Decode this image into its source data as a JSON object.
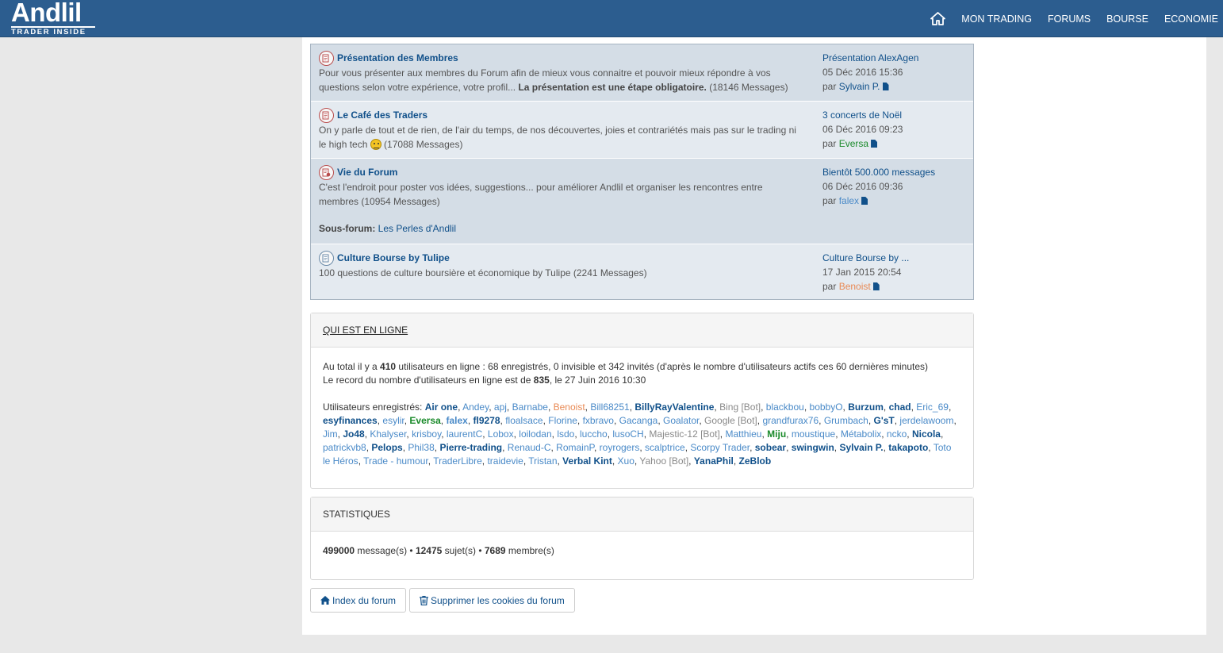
{
  "header": {
    "logo_main": "Andlil",
    "logo_sub": "TRADER INSIDE",
    "nav": [
      "MON TRADING",
      "FORUMS",
      "BOURSE",
      "ECONOMIE"
    ]
  },
  "forums": [
    {
      "title": "Présentation des Membres",
      "desc_start": "Pour vous présenter aux membres du Forum afin de mieux vous connaitre et pouvoir mieux répondre à vos questions selon votre expérience, votre profil... ",
      "desc_bold": "La présentation est une étape obligatoire.",
      "desc_count": " (18146 Messages)",
      "last_title": "Présentation AlexAgen",
      "last_date": "05 Déc 2016 15:36",
      "last_by_prefix": "par ",
      "last_author": "Sylvain P."
    },
    {
      "title": "Le Café des Traders",
      "desc_start": "On y parle de tout et de rien, de l'air du temps, de nos découvertes, joies et contrariétés mais pas sur le trading ni le high tech ",
      "desc_count": " (17088 Messages)",
      "last_title": "3 concerts de Noël",
      "last_date": "06 Déc 2016 09:23",
      "last_by_prefix": "par ",
      "last_author": "Eversa"
    },
    {
      "title": "Vie du Forum",
      "desc_start": "C'est l'endroit pour poster vos idées, suggestions... pour améliorer Andlil et organiser les rencontres entre membres",
      "desc_count": " (10954 Messages)",
      "subforum_label": "Sous-forum:",
      "subforum_link": "Les Perles d'Andlil",
      "last_title": "Bientôt 500.000 messages",
      "last_date": "06 Déc 2016 09:36",
      "last_by_prefix": "par ",
      "last_author": "falex"
    },
    {
      "title": "Culture Bourse by Tulipe",
      "desc_start": "100 questions de culture boursière et économique by Tulipe",
      "desc_count": " (2241 Messages)",
      "last_title": "Culture Bourse by ...",
      "last_date": "17 Jan 2015 20:54",
      "last_by_prefix": "par ",
      "last_author": "Benoist"
    }
  ],
  "online": {
    "title": "QUI EST EN LIGNE",
    "line1_a": "Au total il y a ",
    "line1_total": "410",
    "line1_b": " utilisateurs en ligne : 68 enregistrés, 0 invisible et 342 invités (d'après le nombre d'utilisateurs actifs ces 60 dernières minutes)",
    "line2_a": "Le record du nombre d'utilisateurs en ligne est de ",
    "line2_record": "835",
    "line2_b": ", le 27 Juin 2016 10:30",
    "users_label": "Utilisateurs enregistrés: ",
    "users": [
      {
        "n": "Air one",
        "c": "blue",
        "b": true
      },
      {
        "n": "Andey",
        "c": "light"
      },
      {
        "n": "apj",
        "c": "light"
      },
      {
        "n": "Barnabe",
        "c": "light"
      },
      {
        "n": "Benoist",
        "c": "orange"
      },
      {
        "n": "Bill68251",
        "c": "light"
      },
      {
        "n": "BillyRayValentine",
        "c": "blue",
        "b": true
      },
      {
        "n": "Bing [Bot]",
        "c": "grey"
      },
      {
        "n": "blackbou",
        "c": "light"
      },
      {
        "n": "bobbyO",
        "c": "light"
      },
      {
        "n": "Burzum",
        "c": "blue",
        "b": true
      },
      {
        "n": "chad",
        "c": "blue",
        "b": true
      },
      {
        "n": "Eric_69",
        "c": "light"
      },
      {
        "n": "esyfinances",
        "c": "blue",
        "b": true
      },
      {
        "n": "esylir",
        "c": "light"
      },
      {
        "n": "Eversa",
        "c": "green",
        "b": true
      },
      {
        "n": "falex",
        "c": "light",
        "b": true
      },
      {
        "n": "fl9278",
        "c": "blue",
        "b": true
      },
      {
        "n": "floalsace",
        "c": "light"
      },
      {
        "n": "Florine",
        "c": "light"
      },
      {
        "n": "fxbravo",
        "c": "light"
      },
      {
        "n": "Gacanga",
        "c": "light"
      },
      {
        "n": "Goalator",
        "c": "light"
      },
      {
        "n": "Google [Bot]",
        "c": "grey"
      },
      {
        "n": "grandfurax76",
        "c": "light"
      },
      {
        "n": "Grumbach",
        "c": "light"
      },
      {
        "n": "G'sT",
        "c": "blue",
        "b": true
      },
      {
        "n": "jerdelawoom",
        "c": "light"
      },
      {
        "n": "Jim",
        "c": "light"
      },
      {
        "n": "Jo48",
        "c": "blue",
        "b": true
      },
      {
        "n": "Khalyser",
        "c": "light"
      },
      {
        "n": "krisboy",
        "c": "light"
      },
      {
        "n": "laurentC",
        "c": "light"
      },
      {
        "n": "Lobox",
        "c": "light"
      },
      {
        "n": "loilodan",
        "c": "light"
      },
      {
        "n": "lsdo",
        "c": "light"
      },
      {
        "n": "luccho",
        "c": "light"
      },
      {
        "n": "lusoCH",
        "c": "light"
      },
      {
        "n": "Majestic-12 [Bot]",
        "c": "grey"
      },
      {
        "n": "Matthieu",
        "c": "light"
      },
      {
        "n": "Miju",
        "c": "green",
        "b": true
      },
      {
        "n": "moustique",
        "c": "light"
      },
      {
        "n": "Métabolix",
        "c": "light"
      },
      {
        "n": "ncko",
        "c": "light"
      },
      {
        "n": "Nicola",
        "c": "blue",
        "b": true
      },
      {
        "n": "patrickvb8",
        "c": "light"
      },
      {
        "n": "Pelops",
        "c": "blue",
        "b": true
      },
      {
        "n": "Phil38",
        "c": "light"
      },
      {
        "n": "Pierre-trading",
        "c": "blue",
        "b": true
      },
      {
        "n": "Renaud-C",
        "c": "light"
      },
      {
        "n": "RomainP",
        "c": "light"
      },
      {
        "n": "royrogers",
        "c": "light"
      },
      {
        "n": "scalptrice",
        "c": "light"
      },
      {
        "n": "Scorpy Trader",
        "c": "light"
      },
      {
        "n": "sobear",
        "c": "blue",
        "b": true
      },
      {
        "n": "swingwin",
        "c": "blue",
        "b": true
      },
      {
        "n": "Sylvain P.",
        "c": "blue",
        "b": true
      },
      {
        "n": "takapoto",
        "c": "blue",
        "b": true
      },
      {
        "n": "Toto le Héros",
        "c": "light"
      },
      {
        "n": "Trade - humour",
        "c": "light"
      },
      {
        "n": "TraderLibre",
        "c": "light"
      },
      {
        "n": "traidevie",
        "c": "light"
      },
      {
        "n": "Tristan",
        "c": "light"
      },
      {
        "n": "Verbal Kint",
        "c": "blue",
        "b": true
      },
      {
        "n": "Xuo",
        "c": "light"
      },
      {
        "n": "Yahoo [Bot]",
        "c": "grey"
      },
      {
        "n": "YanaPhil",
        "c": "blue",
        "b": true
      },
      {
        "n": "ZeBlob",
        "c": "blue",
        "b": true
      }
    ]
  },
  "stats": {
    "title": "STATISTIQUES",
    "messages": "499000",
    "messages_label": " message(s) • ",
    "topics": "12475",
    "topics_label": " sujet(s) • ",
    "members": "7689",
    "members_label": " membre(s)"
  },
  "buttons": {
    "index": "Index du forum",
    "cookies": "Supprimer les cookies du forum"
  },
  "colors": {
    "header_bg": "#2c5d8f",
    "link": "#10508a",
    "row_a": "#d4dde6",
    "row_b": "#e4eaf0"
  }
}
